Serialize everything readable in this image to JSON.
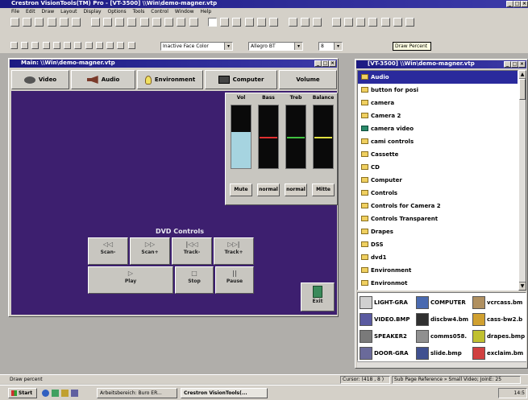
{
  "app": {
    "title": "Crestron VisionTools(TM) Pro - [VT-3500] \\\\Win\\demo-magner.vtp",
    "menu": [
      "File",
      "Edit",
      "Draw",
      "Layout",
      "Display",
      "Options",
      "Tools",
      "Control",
      "Window",
      "Help"
    ]
  },
  "toolbar2": {
    "fill_select": "Inactive Face Color",
    "font_select": "Allegro BT",
    "size_select": "8",
    "tooltip": "Draw Percent"
  },
  "main_window": {
    "title": "Main: \\\\Win\\demo-magner.vtp",
    "tabs": [
      {
        "label": "Video",
        "icon": "speaker-icon"
      },
      {
        "label": "Audio",
        "icon": "audio-icon"
      },
      {
        "label": "Environment",
        "icon": "lightbulb-icon"
      },
      {
        "label": "Computer",
        "icon": "computer-icon"
      },
      {
        "label": "Volume",
        "icon": ""
      }
    ],
    "volume_panel": {
      "channels": [
        {
          "label": "Vol",
          "button": "Mute",
          "level": 0.58,
          "marker_color": "#a6d4e0"
        },
        {
          "label": "Bass",
          "button": "normal",
          "level": 0.5,
          "marker_color": "#e03030"
        },
        {
          "label": "Treb",
          "button": "normal",
          "level": 0.5,
          "marker_color": "#40c040"
        },
        {
          "label": "Balance",
          "button": "Mitte",
          "level": 0.5,
          "marker_color": "#e0e040"
        }
      ]
    },
    "dvd": {
      "title": "DVD Controls",
      "buttons_row1": [
        {
          "label": "Scan-",
          "glyph": "◁◁"
        },
        {
          "label": "Scan+",
          "glyph": "▷▷"
        },
        {
          "label": "Track-",
          "glyph": "|◁◁"
        },
        {
          "label": "Track+",
          "glyph": "▷▷|"
        }
      ],
      "buttons_row2": [
        {
          "label": "Play",
          "glyph": "▷"
        },
        {
          "label": "Stop",
          "glyph": "□"
        },
        {
          "label": "Pause",
          "glyph": "||"
        }
      ]
    },
    "exit_label": "Exit"
  },
  "library_window": {
    "title": "[VT-3500] \\\\Win\\demo-magner.vtp",
    "items": [
      "Audio",
      "button for posi",
      "camera",
      "Camera 2",
      "camera video",
      "cami controls",
      "Cassette",
      "CD",
      "Computer",
      "Controls",
      "Controls for Camera 2",
      "Controls Transparent",
      "Drapes",
      "DSS",
      "dvd1",
      "Environment",
      "Environmot"
    ],
    "thumbnails": [
      [
        "LIGHT-GRA",
        "COMPUTER",
        "vcrcass.bm"
      ],
      [
        "VIDEO.BMP",
        "discbw4.bm",
        "cass-bw2.b"
      ],
      [
        "SPEAKER2",
        "comms058.",
        "drapes.bmp"
      ],
      [
        "DOOR-GRA",
        "slide.bmp",
        "exclaim.bm"
      ]
    ]
  },
  "status": {
    "left": "Draw percent",
    "cursor": "Cursor: (418 , 8 )",
    "subpage": "Sub Page Reference » Small Video; JoinE: 25"
  },
  "taskbar": {
    "start": "Start",
    "tasks": [
      "Arbeitsbereich: Buro ER...",
      "Crestron VisionTools(..."
    ],
    "clock": "14:5"
  },
  "colors": {
    "panel_purple": "#3d1f6f",
    "title_blue": "#1c1a82",
    "selected_blue": "#2a2a9c"
  }
}
